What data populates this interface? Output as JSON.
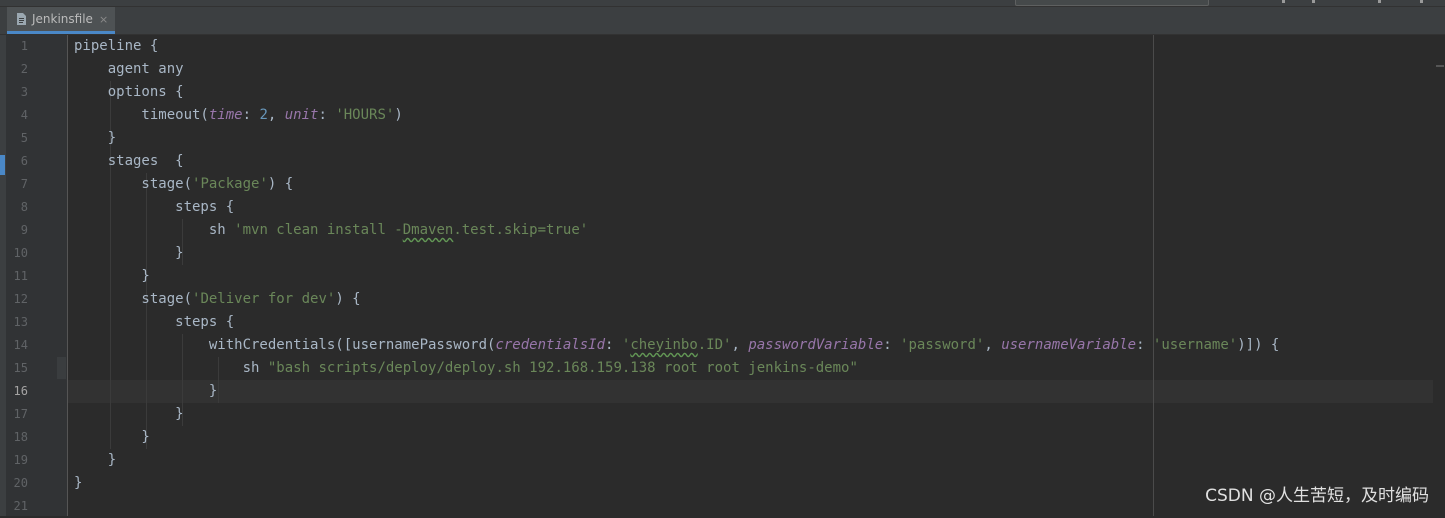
{
  "editor": {
    "tab": {
      "label": "Jenkinsfile",
      "close_glyph": "×",
      "icon": "file-icon"
    },
    "current_line": 16,
    "lines": [
      {
        "n": "1",
        "parts": [
          [
            "p",
            "pipeline {"
          ]
        ]
      },
      {
        "n": "2",
        "parts": [
          [
            "p",
            "    agent any"
          ]
        ]
      },
      {
        "n": "3",
        "parts": [
          [
            "p",
            "    options {"
          ]
        ]
      },
      {
        "n": "4",
        "parts": [
          [
            "p",
            "        timeout("
          ],
          [
            "n",
            "time"
          ],
          [
            "p",
            ": "
          ],
          [
            "num",
            "2"
          ],
          [
            "p",
            ", "
          ],
          [
            "n",
            "unit"
          ],
          [
            "p",
            ": "
          ],
          [
            "s",
            "'HOURS'"
          ],
          [
            "p",
            ")"
          ]
        ]
      },
      {
        "n": "5",
        "parts": [
          [
            "p",
            "    }"
          ]
        ]
      },
      {
        "n": "6",
        "parts": [
          [
            "p",
            "    stages  {"
          ]
        ]
      },
      {
        "n": "7",
        "parts": [
          [
            "p",
            "        stage("
          ],
          [
            "s",
            "'Package'"
          ],
          [
            "p",
            ") {"
          ]
        ]
      },
      {
        "n": "8",
        "parts": [
          [
            "p",
            "            steps {"
          ]
        ]
      },
      {
        "n": "9",
        "parts": [
          [
            "p",
            "                sh "
          ],
          [
            "s",
            "'mvn clean install -"
          ],
          [
            "st",
            "Dmaven"
          ],
          [
            "s",
            ".test.skip=true'"
          ]
        ]
      },
      {
        "n": "10",
        "parts": [
          [
            "p",
            "            }"
          ]
        ]
      },
      {
        "n": "11",
        "parts": [
          [
            "p",
            "        }"
          ]
        ]
      },
      {
        "n": "12",
        "parts": [
          [
            "p",
            "        stage("
          ],
          [
            "s",
            "'Deliver for dev'"
          ],
          [
            "p",
            ") {"
          ]
        ]
      },
      {
        "n": "13",
        "parts": [
          [
            "p",
            "            steps {"
          ]
        ]
      },
      {
        "n": "14",
        "parts": [
          [
            "p",
            "                withCredentials([usernamePassword("
          ],
          [
            "n",
            "credentialsId"
          ],
          [
            "p",
            ": "
          ],
          [
            "s",
            "'"
          ],
          [
            "st",
            "cheyinbo"
          ],
          [
            "s",
            ".ID'"
          ],
          [
            "p",
            ", "
          ],
          [
            "n",
            "passwordVariable"
          ],
          [
            "p",
            ": "
          ],
          [
            "s",
            "'password'"
          ],
          [
            "p",
            ", "
          ],
          [
            "n",
            "usernameVariable"
          ],
          [
            "p",
            ": "
          ],
          [
            "s",
            "'username'"
          ],
          [
            "p",
            ")]) {"
          ]
        ]
      },
      {
        "n": "15",
        "parts": [
          [
            "p",
            "                    sh "
          ],
          [
            "s",
            "\"bash scripts/deploy/deploy.sh 192.168.159.138 root root jenkins-demo\""
          ]
        ]
      },
      {
        "n": "16",
        "parts": [
          [
            "p",
            "                }"
          ]
        ]
      },
      {
        "n": "17",
        "parts": [
          [
            "p",
            "            }"
          ]
        ]
      },
      {
        "n": "18",
        "parts": [
          [
            "p",
            "        }"
          ]
        ]
      },
      {
        "n": "19",
        "parts": [
          [
            "p",
            "    }"
          ]
        ]
      },
      {
        "n": "20",
        "parts": [
          [
            "p",
            "}"
          ]
        ]
      },
      {
        "n": "21",
        "parts": [
          [
            "p",
            ""
          ]
        ]
      }
    ]
  },
  "colors": {
    "background": "#2b2b2b",
    "plain": "#a9b7c6",
    "string": "#6a8759",
    "number": "#6897bb",
    "named_arg": "#9876aa",
    "accent": "#4a88c7"
  },
  "watermark": "CSDN @人生苦短，及时编码"
}
